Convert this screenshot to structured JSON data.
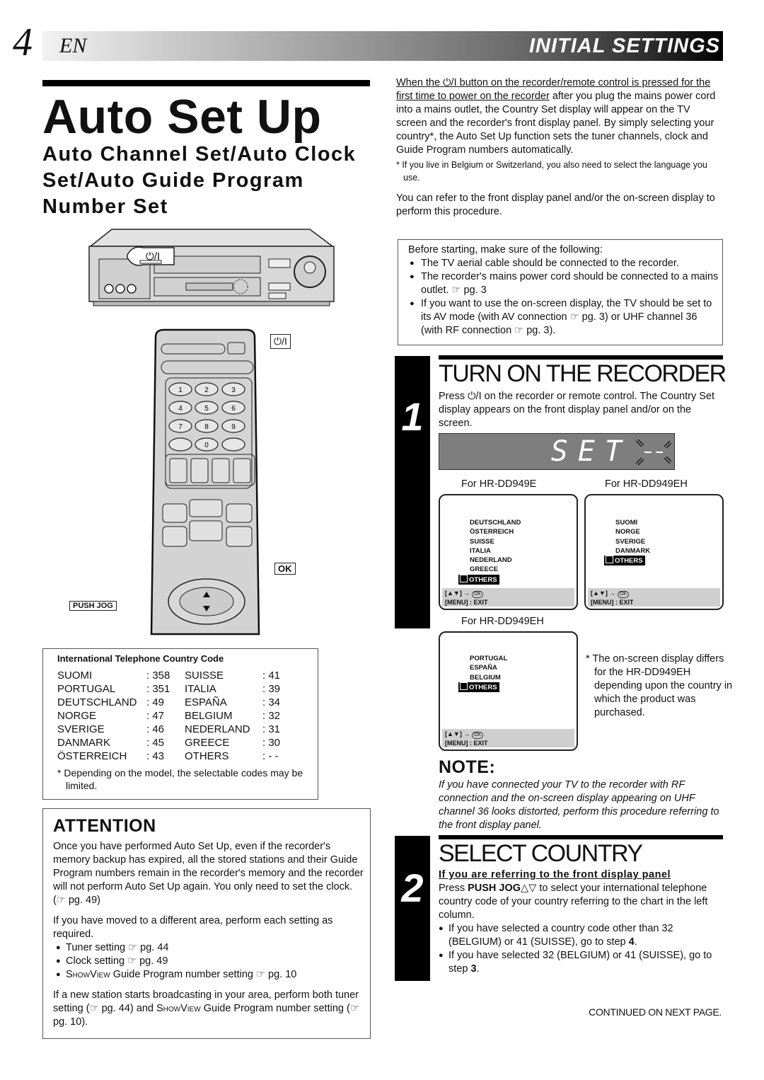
{
  "header": {
    "page_number": "4",
    "language": "EN",
    "section": "INITIAL SETTINGS",
    "band_colors": {
      "start": "#f2f2f2",
      "end": "#000000"
    }
  },
  "title": {
    "main": "Auto Set Up",
    "subtitle": "Auto Channel Set/Auto Clock Set/Auto Guide Program Number Set"
  },
  "illustrations": {
    "vcr_power_label": "⏻/I",
    "remote_power_label": "⏻/I",
    "remote_digits": [
      "1",
      "2",
      "3",
      "4",
      "5",
      "6",
      "7",
      "8",
      "9",
      "0"
    ],
    "ok_callout": "OK",
    "push_jog_callout": "PUSH JOG"
  },
  "country_codes": {
    "heading": "International Telephone Country Code",
    "rows": [
      {
        "c1": "SUOMI",
        "v1": ": 358",
        "c2": "SUISSE",
        "v2": ": 41"
      },
      {
        "c1": "PORTUGAL",
        "v1": ": 351",
        "c2": "ITALIA",
        "v2": ": 39"
      },
      {
        "c1": "DEUTSCHLAND",
        "v1": ": 49",
        "c2": "ESPAÑA",
        "v2": ": 34"
      },
      {
        "c1": "NORGE",
        "v1": ": 47",
        "c2": "BELGIUM",
        "v2": ": 32"
      },
      {
        "c1": "SVERIGE",
        "v1": ": 46",
        "c2": "NEDERLAND",
        "v2": ": 31"
      },
      {
        "c1": "DANMARK",
        "v1": ": 45",
        "c2": "GREECE",
        "v2": ": 30"
      },
      {
        "c1": "ÖSTERREICH",
        "v1": ": 43",
        "c2": "OTHERS",
        "v2": ": - -"
      }
    ],
    "footnote": "* Depending on the model, the selectable codes may be limited."
  },
  "attention": {
    "heading": "ATTENTION",
    "para1": "Once you have performed Auto Set Up, even if the recorder's memory backup has expired, all the stored stations and their Guide Program numbers remain in the recorder's memory and the recorder will not perform Auto Set Up again. You only need to set the clock. (☞ pg. 49)",
    "para2": "If you have moved to a different area, perform each setting as required.",
    "bullets": [
      "Tuner setting ☞ pg. 44",
      "Clock setting ☞ pg. 49"
    ],
    "bullet3_showview": "ShowView",
    "bullet3_rest": " Guide Program number setting ☞ pg. 10",
    "para3_a": "If a new station starts broadcasting in your area, perform both tuner setting (☞ pg. 44) and ",
    "para3_showview": "ShowView",
    "para3_b": " Guide Program number setting (☞ pg. 10)."
  },
  "intro": {
    "underlined": "When the ⏻/I button on the recorder/remote control is pressed for the first time to power on the recorder",
    "rest": " after you plug the mains power cord into a mains outlet, the Country Set display will appear on the TV screen and the recorder's front display panel. By simply selecting your country*, the Auto Set Up function sets the tuner channels, clock and Guide Program numbers automatically.",
    "footnote": "* If you live in Belgium or Switzerland, you also need to select the language you use.",
    "para2": "You can refer to the front display panel and/or the on-screen display to perform this procedure."
  },
  "before_starting": {
    "heading": "Before starting, make sure of the following:",
    "items": [
      "The TV aerial cable should be connected to the recorder.",
      "The recorder's mains power cord should be connected to a mains outlet. ☞ pg. 3",
      "If you want to use the on-screen display, the TV should be set to its AV mode (with AV connection ☞ pg. 3) or UHF channel 36 (with RF connection ☞ pg. 3)."
    ]
  },
  "step1": {
    "number": "1",
    "title": "TURN ON THE RECORDER",
    "text": "Press ⏻/I on the recorder or remote control. The Country Set display appears on the front display panel and/or on the screen.",
    "lcd_text": "SET",
    "lcd_blink": "--",
    "osd_screens": [
      {
        "label": "For HR-DD949E",
        "countries": [
          "DEUTSCHLAND",
          "ÖSTERREICH",
          "SUISSE",
          "ITALIA",
          "NEDERLAND",
          "GREECE"
        ],
        "selected": "OTHERS",
        "nav_hint": "[▲▼] →",
        "ok_badge": "OK",
        "exit_hint": "[MENU] : EXIT"
      },
      {
        "label": "For HR-DD949EH",
        "countries": [
          "SUOMI",
          "NORGE",
          "SVERIGE",
          "DANMARK"
        ],
        "selected": "OTHERS",
        "nav_hint": "[▲▼] →",
        "ok_badge": "OK",
        "exit_hint": "[MENU] : EXIT"
      },
      {
        "label": "For HR-DD949EH",
        "countries": [
          "PORTUGAL",
          "ESPAÑA",
          "BELGIUM"
        ],
        "selected": "OTHERS",
        "nav_hint": "[▲▼] →",
        "ok_badge": "OK",
        "exit_hint": "[MENU] : EXIT"
      }
    ],
    "osd_note": "* The on-screen display differs for the HR-DD949EH depending upon the country in which the product was purchased."
  },
  "note": {
    "heading": "NOTE:",
    "text": "If you have connected your TV to the recorder with RF connection and the on-screen display appearing on UHF channel 36 looks distorted, perform this procedure referring to the front display panel."
  },
  "step2": {
    "number": "2",
    "title": "SELECT COUNTRY",
    "subheading": "If you are referring to the front display panel",
    "text_a": "Press ",
    "text_bold": "PUSH JOG",
    "text_b": "△▽ to select your international telephone country code of your country referring to the chart in the left column.",
    "bullet1_a": "If you have selected a country code other than 32 (BELGIUM) or 41 (SUISSE), go to step ",
    "bullet1_step": "4",
    "bullet2_a": "If you have selected 32 (BELGIUM) or 41 (SUISSE), go to step ",
    "bullet2_step": "3"
  },
  "footer": {
    "continued": "CONTINUED ON NEXT PAGE."
  }
}
